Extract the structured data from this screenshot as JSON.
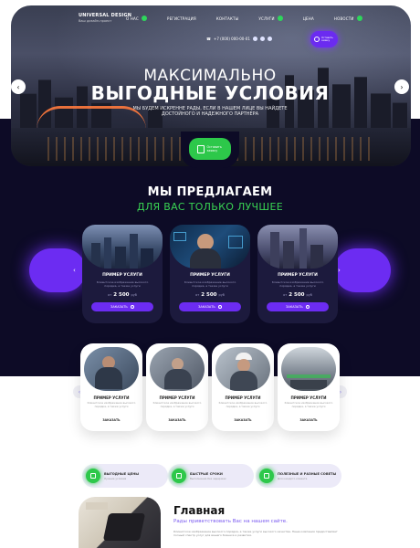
{
  "brand": {
    "title": "UNIVERSAL DESIGN",
    "tagline": "Ваш дизайн-проект"
  },
  "menu": [
    {
      "label": "О НАС",
      "badge": true
    },
    {
      "label": "РЕГИСТРАЦИЯ",
      "badge": false
    },
    {
      "label": "КОНТАКТЫ",
      "badge": false
    },
    {
      "label": "УСЛУГИ",
      "badge": true
    },
    {
      "label": "ЦЕНА",
      "badge": false
    },
    {
      "label": "НОВОСТИ",
      "badge": true
    }
  ],
  "header": {
    "phone": "+7 (000) 000-00-01",
    "top_cta": "Оставить заявку"
  },
  "hero": {
    "title_line1": "МАКСИМАЛЬНО",
    "title_line2": "ВЫГОДНЫЕ УСЛОВИЯ",
    "subtitle": "МЫ БУДЕМ ИСКРЕННЕ РАДЫ, ЕСЛИ В НАШЕМ ЛИЦЕ ВЫ НАЙДЕТЕ ДОСТОЙНОГО И НАДЕЖНОГО ПАРТНЕРА",
    "cta": "Оставить заявку"
  },
  "offer": {
    "heading": "МЫ ПРЕДЛАГАЕМ",
    "subheading": "ДЛЯ ВАС ТОЛЬКО ЛУЧШЕЕ",
    "cards": [
      {
        "name": "ПРИМЕР УСЛУГИ",
        "desc": "Клиентское изображение высокого порядка, а также услуги",
        "prefix": "от",
        "price": "2 500",
        "currency": "руб",
        "button": "ЗАКАЗАТЬ"
      },
      {
        "name": "ПРИМЕР УСЛУГИ",
        "desc": "Клиентское изображение высокого порядка, а также услуги",
        "prefix": "от",
        "price": "2 500",
        "currency": "руб",
        "button": "ЗАКАЗАТЬ"
      },
      {
        "name": "ПРИМЕР УСЛУГИ",
        "desc": "Клиентское изображение высокого порядка, а также услуги",
        "prefix": "от",
        "price": "2 500",
        "currency": "руб",
        "button": "ЗАКАЗАТЬ"
      }
    ]
  },
  "services": [
    {
      "name": "ПРИМЕР УСЛУГИ",
      "desc": "Клиентское изображение высокого порядка, а также услуги",
      "button": "ЗАКАЗАТЬ"
    },
    {
      "name": "ПРИМЕР УСЛУГИ",
      "desc": "Клиентское изображение высокого порядка, а также услуги",
      "button": "ЗАКАЗАТЬ"
    },
    {
      "name": "ПРИМЕР УСЛУГИ",
      "desc": "Клиентское изображение высокого порядка, а также услуги",
      "button": "ЗАКАЗАТЬ"
    },
    {
      "name": "ПРИМЕР УСЛУГИ",
      "desc": "Клиентское изображение высокого порядка, а также услуги",
      "button": "ЗАКАЗАТЬ"
    }
  ],
  "features": [
    {
      "title": "ВЫГОДНЫЕ ЦЕНЫ",
      "sub": "Лучшие условия"
    },
    {
      "title": "БЫСТРЫЕ СРОКИ",
      "sub": "Выполнение без задержек"
    },
    {
      "title": "ПОЛЕЗНЫЕ И РАЗНЫЕ СОВЕТЫ",
      "sub": "Для каждого клиента"
    }
  ],
  "main": {
    "title": "Главная",
    "subtitle": "Рады приветствовать Вас на нашем сайте.",
    "text": "Клиентское изображение высокого порядка, а также услуги высокого качества. Наша компания предоставляет полный спектр услуг для вашего бизнеса и развития."
  },
  "colors": {
    "accent": "#6c2cf2",
    "green": "#2dc84a",
    "dark": "#0d0b26"
  },
  "icons": {
    "left": "arrow-left-icon",
    "right": "arrow-right-icon"
  }
}
